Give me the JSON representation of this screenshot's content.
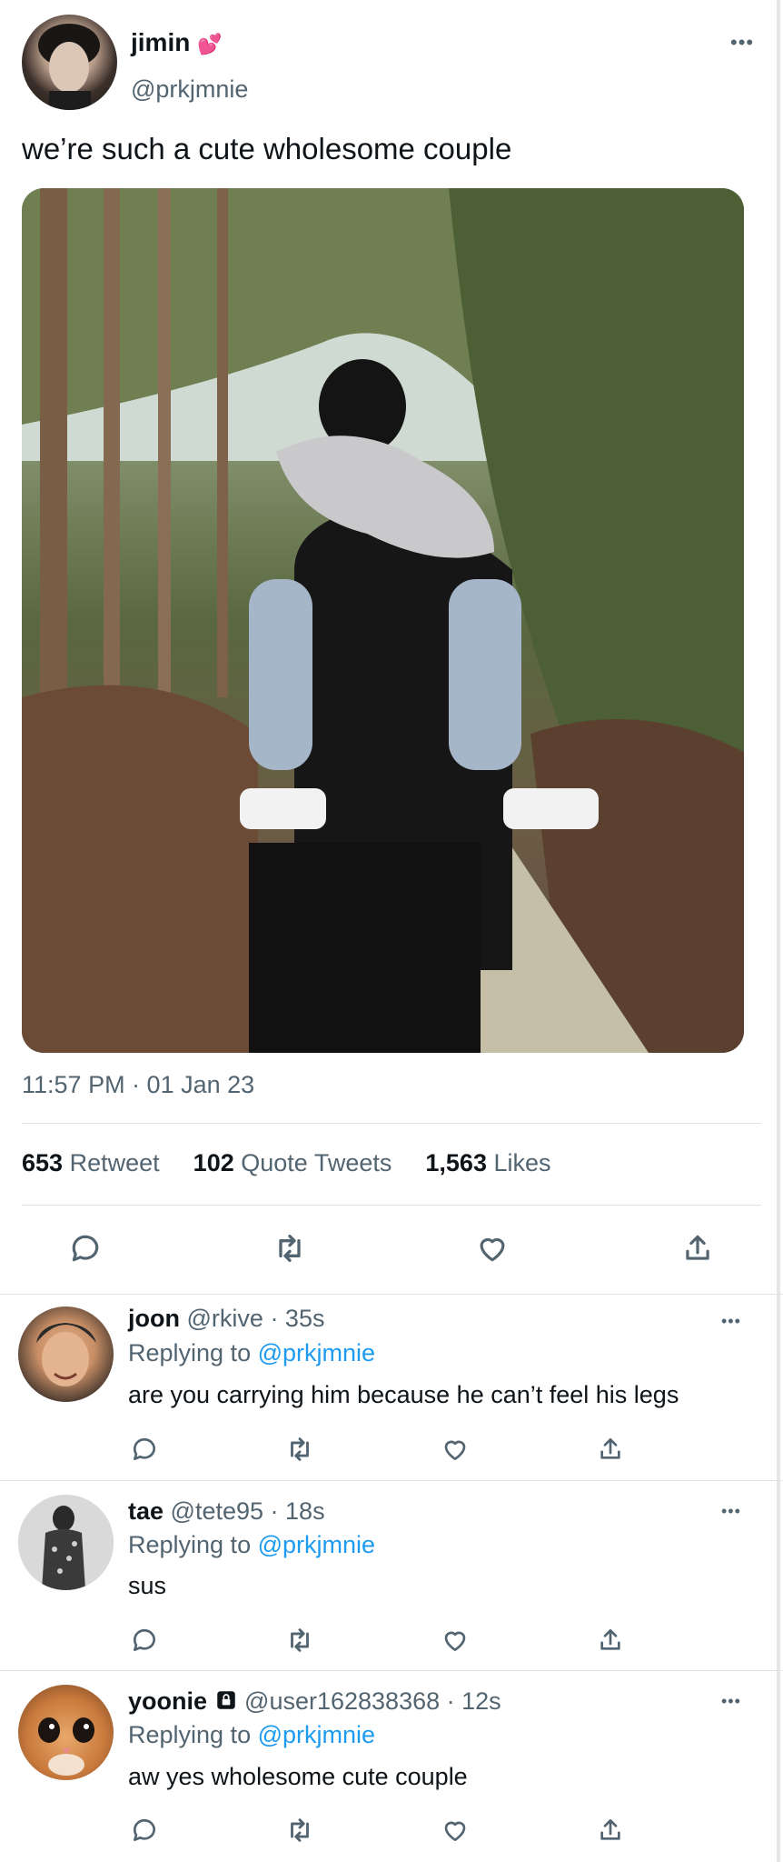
{
  "tweet": {
    "author_name": "jimin",
    "author_emoji": "💕",
    "handle": "@prkjmnie",
    "text": "we’re such a cute wholesome couple",
    "timestamp": "11:57 PM · 01 Jan 23",
    "stats": {
      "retweets_count": "653",
      "retweets_label": "Retweet",
      "quotes_count": "102",
      "quotes_label": "Quote Tweets",
      "likes_count": "1,563",
      "likes_label": "Likes"
    }
  },
  "replies": [
    {
      "name": "joon",
      "handle": "@rkive",
      "time": "· 35s",
      "replying_label": "Replying to",
      "replying_to": "@prkjmnie",
      "text": "are you carrying him because he can’t feel his legs",
      "locked": false
    },
    {
      "name": "tae",
      "handle": "@tete95",
      "time": "· 18s",
      "replying_label": "Replying to",
      "replying_to": "@prkjmnie",
      "text": "sus",
      "locked": false
    },
    {
      "name": "yoonie",
      "handle": "@user162838368",
      "time": "· 12s",
      "replying_label": "Replying to",
      "replying_to": "@prkjmnie",
      "text": "aw yes wholesome cute couple",
      "locked": true
    }
  ],
  "colors": {
    "link": "#1d9bf0",
    "secondary_text": "#536471",
    "divider": "#e1e4e7"
  },
  "icons": [
    "more-icon",
    "reply-icon",
    "retweet-icon",
    "like-icon",
    "share-icon",
    "lock-icon"
  ]
}
